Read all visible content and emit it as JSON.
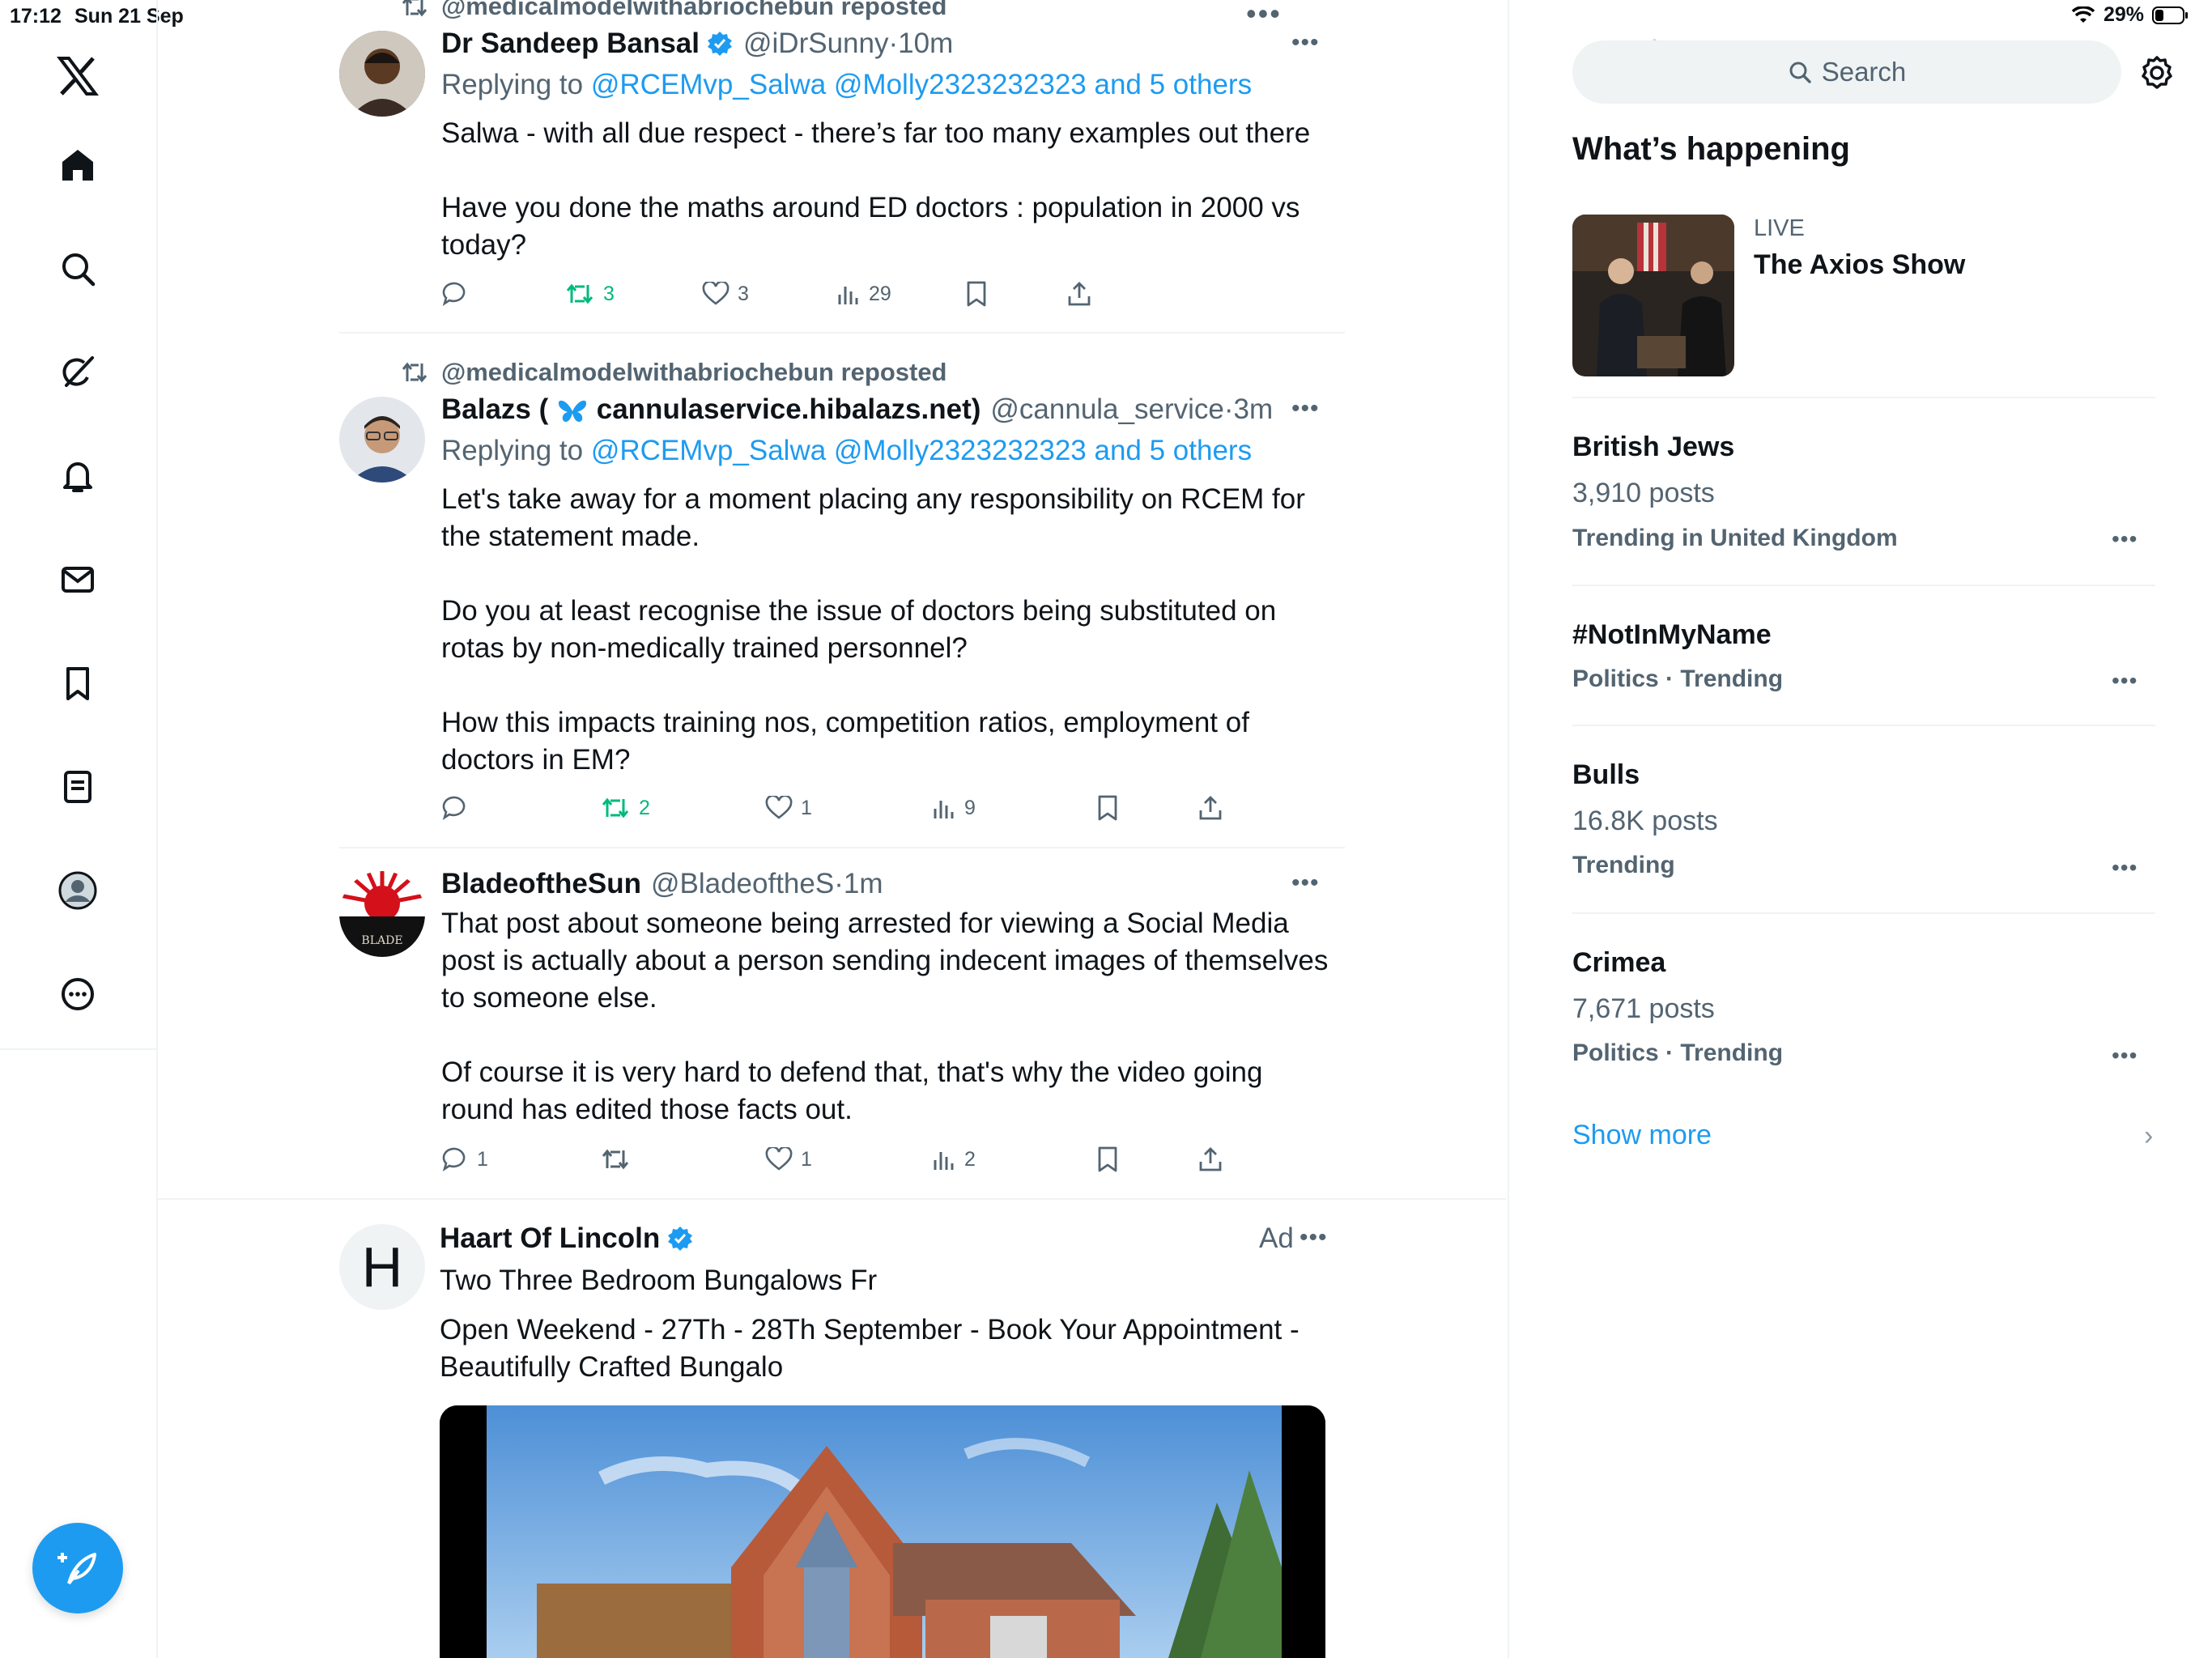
{
  "status": {
    "time": "17:12",
    "date": "Sun 21 Sep",
    "battery": "29%"
  },
  "colors": {
    "accent": "#1d9bf0",
    "repost_green": "#00ba7c",
    "secondary_text": "#536471"
  },
  "nav": {
    "items": [
      "x-logo-icon",
      "home-icon",
      "search-icon",
      "grok-icon",
      "notifications-icon",
      "messages-icon",
      "bookmarks-icon",
      "lists-icon",
      "profile-icon",
      "more-icon"
    ],
    "compose_icon": "feather-plus-icon"
  },
  "timeline": {
    "top_partial_repost": "@medicalmodelwithabriochebun reposted",
    "tweets": [
      {
        "name": "Dr Sandeep Bansal",
        "verified": true,
        "handle": "@iDrSunny",
        "time": "10m",
        "reply_prefix": "Replying to",
        "reply_links": "@RCEMvp_Salwa @Molly2323232323 and 5 others",
        "text": "Salwa - with all due respect - there’s far too many examples out there\n\nHave you done the maths around ED doctors : population in 2000 vs today?",
        "stats": {
          "replies": "",
          "reposts": "3",
          "likes": "3",
          "views": "29"
        }
      },
      {
        "repost_label": "@medicalmodelwithabriochebun reposted",
        "name_prefix": "Balazs (",
        "name_suffix": "cannulaservice.hibalazs.net)",
        "handle": "@cannula_service",
        "time": "3m",
        "reply_prefix": "Replying to",
        "reply_links": "@RCEMvp_Salwa @Molly2323232323 and 5 others",
        "text": "Let's take away for a moment placing any responsibility on RCEM for the statement made.\n\nDo you at least recognise the issue of doctors being substituted on rotas by non-medically trained personnel?\n\nHow this impacts training nos, competition ratios, employment of doctors in EM?",
        "stats": {
          "replies": "",
          "reposts": "2",
          "likes": "1",
          "views": "9"
        }
      },
      {
        "name": "BladeoftheSun",
        "handle": "@BladeoftheS",
        "time": "1m",
        "text": "That post about someone being arrested for viewing a Social Media post is actually about a person sending indecent images of themselves to someone else.\n\nOf course it is very hard to defend that, that's why the video going round has edited those facts out.",
        "stats": {
          "replies": "1",
          "reposts": "",
          "likes": "1",
          "views": "2"
        }
      }
    ],
    "ad": {
      "avatar_letter": "H",
      "name": "Haart Of Lincoln",
      "verified": true,
      "ad_label": "Ad",
      "subtitle": "Two Three Bedroom Bungalows Fr",
      "text": "Open Weekend - 27Th - 28Th September - Book Your Appointment - Beautifully Crafted Bungalo"
    }
  },
  "sidebar": {
    "search_placeholder": "Search",
    "section_title": "What’s happening",
    "live": {
      "label": "LIVE",
      "title": "The Axios Show"
    },
    "trends": [
      {
        "title": "British Jews",
        "posts": "3,910 posts",
        "meta": "Trending in United Kingdom"
      },
      {
        "title": "#NotInMyName",
        "posts": "",
        "meta": "Politics · Trending"
      },
      {
        "title": "Bulls",
        "posts": "16.8K posts",
        "meta": "Trending"
      },
      {
        "title": "Crimea",
        "posts": "7,671 posts",
        "meta": "Politics · Trending"
      }
    ],
    "show_more": "Show more"
  }
}
